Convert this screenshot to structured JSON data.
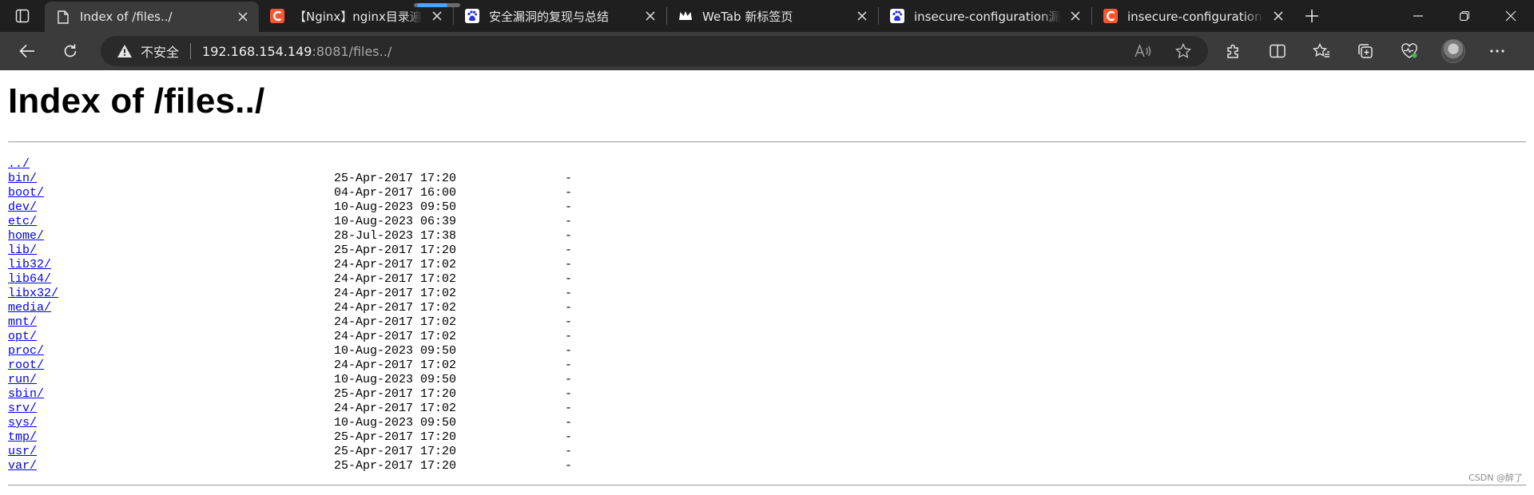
{
  "browser": {
    "tabs": [
      {
        "title": "Index of /files../",
        "favicon": "page-icon",
        "active": true
      },
      {
        "title": "【Nginx】nginx目录遍历漏洞",
        "favicon": "csdn-icon",
        "active": false
      },
      {
        "title": "安全漏洞的复现与总结",
        "favicon": "baidu-paw-icon",
        "active": false
      },
      {
        "title": "WeTab 新标签页",
        "favicon": "wetab-crown-icon",
        "active": false
      },
      {
        "title": "insecure-configuration漏洞",
        "favicon": "baidu-paw-icon",
        "active": false
      },
      {
        "title": "insecure-configuration --复",
        "favicon": "csdn-icon",
        "active": false
      }
    ],
    "address_bar": {
      "security_label": "不安全",
      "url_host": "192.168.154.149",
      "url_rest": ":8081/files../"
    }
  },
  "page": {
    "title": "Index of /files../",
    "entries": [
      {
        "name": "../",
        "date": "",
        "size": ""
      },
      {
        "name": "bin/",
        "date": "25-Apr-2017 17:20",
        "size": "-"
      },
      {
        "name": "boot/",
        "date": "04-Apr-2017 16:00",
        "size": "-"
      },
      {
        "name": "dev/",
        "date": "10-Aug-2023 09:50",
        "size": "-"
      },
      {
        "name": "etc/",
        "date": "10-Aug-2023 06:39",
        "size": "-"
      },
      {
        "name": "home/",
        "date": "28-Jul-2023 17:38",
        "size": "-"
      },
      {
        "name": "lib/",
        "date": "25-Apr-2017 17:20",
        "size": "-"
      },
      {
        "name": "lib32/",
        "date": "24-Apr-2017 17:02",
        "size": "-"
      },
      {
        "name": "lib64/",
        "date": "24-Apr-2017 17:02",
        "size": "-"
      },
      {
        "name": "libx32/",
        "date": "24-Apr-2017 17:02",
        "size": "-"
      },
      {
        "name": "media/",
        "date": "24-Apr-2017 17:02",
        "size": "-"
      },
      {
        "name": "mnt/",
        "date": "24-Apr-2017 17:02",
        "size": "-"
      },
      {
        "name": "opt/",
        "date": "24-Apr-2017 17:02",
        "size": "-"
      },
      {
        "name": "proc/",
        "date": "10-Aug-2023 09:50",
        "size": "-"
      },
      {
        "name": "root/",
        "date": "24-Apr-2017 17:02",
        "size": "-"
      },
      {
        "name": "run/",
        "date": "10-Aug-2023 09:50",
        "size": "-"
      },
      {
        "name": "sbin/",
        "date": "25-Apr-2017 17:20",
        "size": "-"
      },
      {
        "name": "srv/",
        "date": "24-Apr-2017 17:02",
        "size": "-"
      },
      {
        "name": "sys/",
        "date": "10-Aug-2023 09:50",
        "size": "-"
      },
      {
        "name": "tmp/",
        "date": "25-Apr-2017 17:20",
        "size": "-"
      },
      {
        "name": "usr/",
        "date": "25-Apr-2017 17:20",
        "size": "-"
      },
      {
        "name": "var/",
        "date": "25-Apr-2017 17:20",
        "size": "-"
      }
    ],
    "watermark": "CSDN @醉了"
  },
  "colors": {
    "tabstrip_bg": "#1f1f1f",
    "toolbar_bg": "#3b3b3b",
    "link": "#0000ee",
    "csdn_red": "#fc5531",
    "baidu_blue": "#2932e1"
  }
}
